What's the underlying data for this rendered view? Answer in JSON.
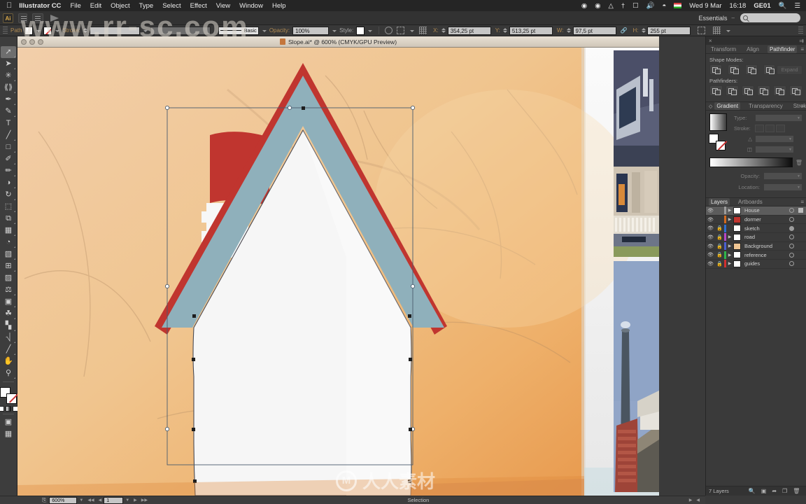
{
  "macbar": {
    "apple": "apple-logo",
    "app_name": "Illustrator CC",
    "menus": [
      "File",
      "Edit",
      "Object",
      "Type",
      "Select",
      "Effect",
      "View",
      "Window",
      "Help"
    ],
    "status_items": [
      "record-icon",
      "dropbox-icon",
      "cloud-icon",
      "bluetooth-icon",
      "airplay-icon",
      "volume-icon",
      "wifi-icon"
    ],
    "flag": "hungary-flag",
    "date": "Wed 9 Mar",
    "time": "16:18",
    "user": "GE01",
    "search_icon": "search-icon",
    "list_icon": "notification-center-icon"
  },
  "appbar": {
    "logo": "Ai",
    "workspace": "Essentials",
    "workspace_arrow": "–",
    "search_placeholder": ""
  },
  "controlbar": {
    "path_label": "Path",
    "fill_swatch": "#ffffff",
    "stroke_label": "Stroke:",
    "stroke_weight": "",
    "profile_label": "",
    "brush_def": "Basic",
    "opacity_label": "Opacity:",
    "opacity_value": "100%",
    "style_label": "Style:",
    "x_label": "X:",
    "x_value": "354,25 pt",
    "y_label": "Y:",
    "y_value": "513,25 pt",
    "w_label": "W:",
    "w_value": "97,5 pt",
    "h_label": "H:",
    "h_value": "255 pt",
    "link_icon": "link-icon",
    "transform_icon": "transform-icon",
    "align_icon": "align-icon"
  },
  "toolbar": {
    "tools": [
      {
        "name": "selection-tool",
        "glyph": "⬈",
        "active": true
      },
      {
        "name": "direct-selection-tool",
        "glyph": "⬈",
        "active": false
      },
      {
        "name": "magic-wand-tool",
        "glyph": "✳",
        "active": false
      },
      {
        "name": "lasso-tool",
        "glyph": "❀",
        "active": false
      },
      {
        "name": "pen-tool",
        "glyph": "✒",
        "active": false
      },
      {
        "name": "curvature-tool",
        "glyph": "✎",
        "active": false
      },
      {
        "name": "type-tool",
        "glyph": "T",
        "active": false
      },
      {
        "name": "line-segment-tool",
        "glyph": "╱",
        "active": false
      },
      {
        "name": "rectangle-tool",
        "glyph": "□",
        "active": false
      },
      {
        "name": "paintbrush-tool",
        "glyph": "✐",
        "active": false
      },
      {
        "name": "shaper-tool",
        "glyph": "✏",
        "active": false
      },
      {
        "name": "eraser-tool",
        "glyph": "◑",
        "active": false
      },
      {
        "name": "rotate-tool",
        "glyph": "↻",
        "active": false
      },
      {
        "name": "scale-tool",
        "glyph": "⬚",
        "active": false
      },
      {
        "name": "width-tool",
        "glyph": "⧉",
        "active": false
      },
      {
        "name": "free-transform-tool",
        "glyph": "▦",
        "active": false
      },
      {
        "name": "shape-builder-tool",
        "glyph": "◔",
        "active": false
      },
      {
        "name": "perspective-grid-tool",
        "glyph": "▧",
        "active": false
      },
      {
        "name": "mesh-tool",
        "glyph": "⊞",
        "active": false
      },
      {
        "name": "gradient-tool",
        "glyph": "▨",
        "active": false
      },
      {
        "name": "eyedropper-tool",
        "glyph": "⚗",
        "active": false
      },
      {
        "name": "blend-tool",
        "glyph": "▣",
        "active": false
      },
      {
        "name": "symbol-sprayer-tool",
        "glyph": "☘",
        "active": false
      },
      {
        "name": "column-graph-tool",
        "glyph": "ὌA",
        "active": false
      },
      {
        "name": "artboard-tool",
        "glyph": "⌷",
        "active": false
      },
      {
        "name": "slice-tool",
        "glyph": "✂",
        "active": false
      },
      {
        "name": "hand-tool",
        "glyph": "✋",
        "active": false
      },
      {
        "name": "zoom-tool",
        "glyph": "⚲",
        "active": false
      }
    ]
  },
  "document": {
    "title": "Slope.ai* @ 600% (CMYK/GPU Preview)",
    "icon": "ai-document-icon"
  },
  "pathfinder_panel": {
    "tabs": [
      "Transform",
      "Align",
      "Pathfinder"
    ],
    "selected_tab": "Pathfinder",
    "shape_modes_label": "Shape Modes:",
    "pathfinders_label": "Pathfinders:",
    "expand_label": "Expand",
    "shape_mode_buttons": [
      "unite-icon",
      "minus-front-icon",
      "intersect-icon",
      "exclude-icon"
    ],
    "pathfinder_buttons": [
      "divide-icon",
      "trim-icon",
      "merge-icon",
      "crop-icon",
      "outline-icon",
      "minus-back-icon"
    ]
  },
  "gradient_panel": {
    "tabs": [
      "Gradient",
      "Transparency",
      "Stroke"
    ],
    "selected_tab": "Gradient",
    "type_label": "Type:",
    "type_value": "",
    "stroke_label": "Stroke:",
    "angle_label": "angle-icon",
    "aspect_label": "aspect-ratio-icon",
    "opacity_label": "Opacity:",
    "opacity_value": "",
    "location_label": "Location:",
    "location_value": ""
  },
  "layers_panel": {
    "tabs": [
      "Layers",
      "Artboards"
    ],
    "selected_tab": "Layers",
    "layers": [
      {
        "name": "House",
        "color": "#9c9c9c",
        "visible": true,
        "locked": false,
        "selected": true,
        "has_selection": true
      },
      {
        "name": "dormer",
        "color": "#d2691e",
        "visible": true,
        "locked": false,
        "selected": false,
        "has_selection": false
      },
      {
        "name": "sketch",
        "color": "#2f6fd0",
        "visible": true,
        "locked": true,
        "selected": false,
        "has_selection": false
      },
      {
        "name": "road",
        "color": "#b546c8",
        "visible": true,
        "locked": true,
        "selected": false,
        "has_selection": false
      },
      {
        "name": "Background",
        "color": "#4a5fd0",
        "visible": true,
        "locked": true,
        "selected": false,
        "has_selection": false
      },
      {
        "name": "reference",
        "color": "#2fb44a",
        "visible": true,
        "locked": true,
        "selected": false,
        "has_selection": false
      },
      {
        "name": "guides",
        "color": "#d03030",
        "visible": true,
        "locked": true,
        "selected": false,
        "has_selection": false
      }
    ],
    "footer_count": "7 Layers",
    "footer_icons": [
      "locate-object-icon",
      "make-mask-icon",
      "make-sublayer-icon",
      "new-layer-icon",
      "delete-layer-icon"
    ]
  },
  "statusbar": {
    "zoom": "600%",
    "page": "1",
    "tool_status": "Selection"
  },
  "watermark": {
    "top": "www.rr-sc.com",
    "center": "人人素材",
    "logo": "M"
  },
  "artwork": {
    "background_color": "#f0c693",
    "roof_edge_color": "#c0352f",
    "roof_color": "#8fb0bb",
    "body_color": "#f5f5f5",
    "flag_color": "#c0352f",
    "selection_color": "#3d7fc1"
  }
}
